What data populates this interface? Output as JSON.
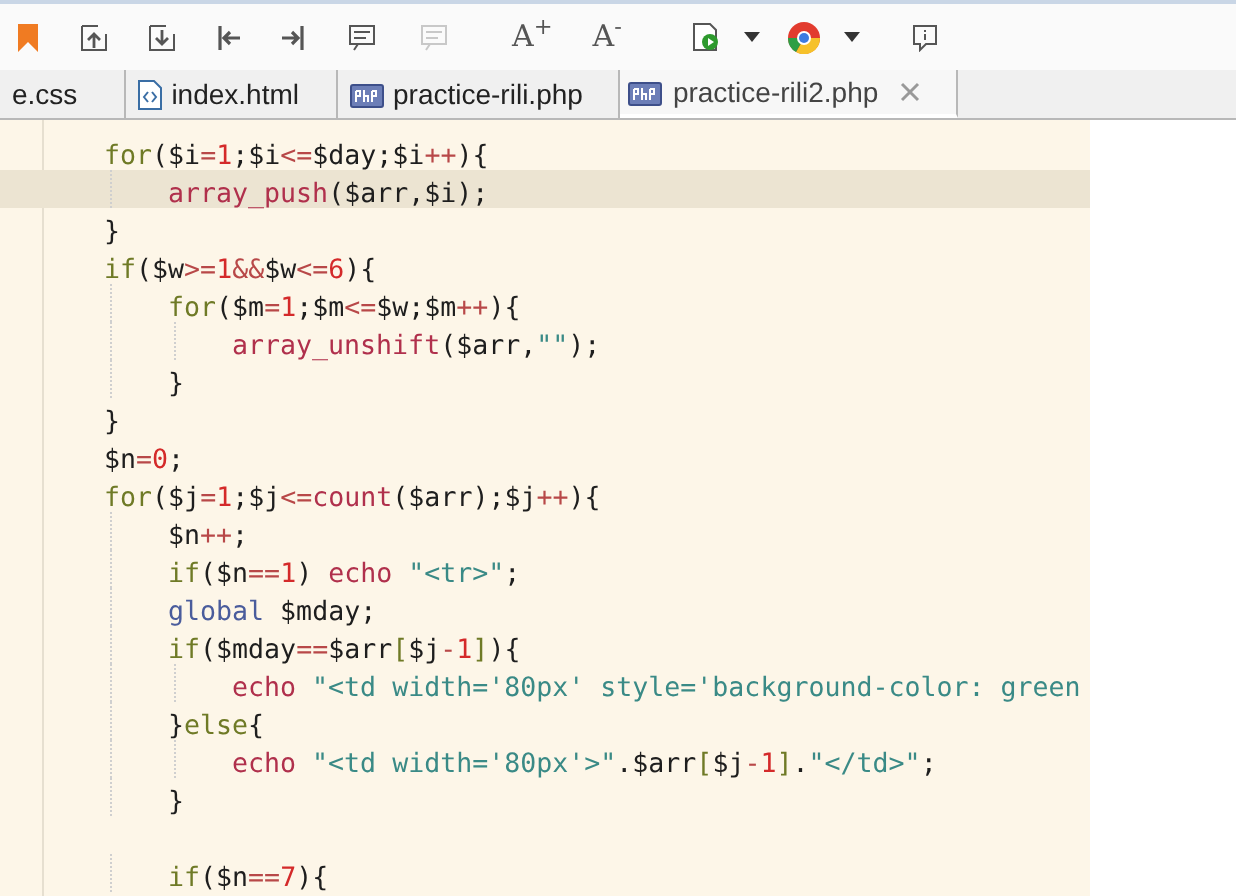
{
  "toolbar": [
    {
      "kind": "bookmark",
      "disabled": false
    },
    {
      "kind": "import",
      "disabled": false
    },
    {
      "kind": "export",
      "disabled": false
    },
    {
      "kind": "go-first",
      "disabled": false
    },
    {
      "kind": "go-last",
      "disabled": false
    },
    {
      "kind": "comment",
      "disabled": false
    },
    {
      "kind": "comment",
      "disabled": true
    },
    {
      "kind": "text",
      "label": "A$^{+}$",
      "disabled": false
    },
    {
      "kind": "text",
      "label": "A$^{-}$",
      "disabled": false
    },
    {
      "kind": "run",
      "disabled": false
    },
    {
      "kind": "caret",
      "disabled": false
    },
    {
      "kind": "browser",
      "disabled": false
    },
    {
      "kind": "caret",
      "disabled": false
    },
    {
      "kind": "info",
      "disabled": false
    }
  ],
  "tabs": [
    {
      "label": "e.css",
      "kind": "css",
      "selected": false
    },
    {
      "label": "index.html",
      "kind": "html",
      "selected": false
    },
    {
      "label": "practice-rili.php",
      "kind": "php",
      "selected": false
    },
    {
      "label": "practice-rili2.php",
      "kind": "php",
      "selected": true,
      "closable": true
    }
  ],
  "code": [
    {
      "tokens": [
        {
          "kind": "kw",
          "text": "for"
        },
        {
          "kind": "p",
          "text": "($i"
        },
        {
          "kind": "op",
          "text": "="
        },
        {
          "kind": "num",
          "text": "1"
        },
        {
          "kind": "p",
          "text": ";$i"
        },
        {
          "kind": "op",
          "text": "<="
        },
        {
          "kind": "p",
          "text": "$day;$i"
        },
        {
          "kind": "op",
          "text": "++"
        },
        {
          "kind": "p",
          "text": "){"
        }
      ],
      "children": [
        {
          "highlighted": true,
          "tokens": [
            {
              "kind": "fn",
              "text": "array_push"
            },
            {
              "kind": "p",
              "text": "($arr,$i);"
            }
          ]
        }
      ]
    },
    {
      "tokens": [
        {
          "kind": "p",
          "text": "}"
        }
      ]
    },
    {
      "tokens": [
        {
          "kind": "kw",
          "text": "if"
        },
        {
          "kind": "p",
          "text": "($w"
        },
        {
          "kind": "op",
          "text": ">="
        },
        {
          "kind": "num",
          "text": "1"
        },
        {
          "kind": "op",
          "text": "&&"
        },
        {
          "kind": "p",
          "text": "$w"
        },
        {
          "kind": "op",
          "text": "<="
        },
        {
          "kind": "num",
          "text": "6"
        },
        {
          "kind": "p",
          "text": "){"
        }
      ],
      "children": [
        {
          "tokens": [
            {
              "kind": "kw",
              "text": "for"
            },
            {
              "kind": "p",
              "text": "($m"
            },
            {
              "kind": "op",
              "text": "="
            },
            {
              "kind": "num",
              "text": "1"
            },
            {
              "kind": "p",
              "text": ";$m"
            },
            {
              "kind": "op",
              "text": "<="
            },
            {
              "kind": "p",
              "text": "$w;$m"
            },
            {
              "kind": "op",
              "text": "++"
            },
            {
              "kind": "p",
              "text": "){"
            }
          ],
          "children": [
            {
              "tokens": [
                {
                  "kind": "fn",
                  "text": "array_unshift"
                },
                {
                  "kind": "p",
                  "text": "($arr,"
                },
                {
                  "kind": "str",
                  "text": "\"\""
                },
                {
                  "kind": "p",
                  "text": ");"
                }
              ]
            }
          ]
        },
        {
          "tokens": [
            {
              "kind": "p",
              "text": "}"
            }
          ]
        }
      ]
    },
    {
      "tokens": [
        {
          "kind": "p",
          "text": "}"
        }
      ]
    },
    {
      "tokens": [
        {
          "kind": "p",
          "text": "$n"
        },
        {
          "kind": "op",
          "text": "="
        },
        {
          "kind": "num",
          "text": "0"
        },
        {
          "kind": "p",
          "text": ";"
        }
      ]
    },
    {
      "tokens": [
        {
          "kind": "kw",
          "text": "for"
        },
        {
          "kind": "p",
          "text": "($j"
        },
        {
          "kind": "op",
          "text": "="
        },
        {
          "kind": "num",
          "text": "1"
        },
        {
          "kind": "p",
          "text": ";$j"
        },
        {
          "kind": "op",
          "text": "<="
        },
        {
          "kind": "fn",
          "text": "count"
        },
        {
          "kind": "p",
          "text": "($arr);$j"
        },
        {
          "kind": "op",
          "text": "++"
        },
        {
          "kind": "p",
          "text": "){"
        }
      ],
      "children": [
        {
          "tokens": [
            {
              "kind": "p",
              "text": "$n"
            },
            {
              "kind": "op",
              "text": "++"
            },
            {
              "kind": "p",
              "text": ";"
            }
          ]
        },
        {
          "tokens": [
            {
              "kind": "kw",
              "text": "if"
            },
            {
              "kind": "p",
              "text": "($n"
            },
            {
              "kind": "op",
              "text": "=="
            },
            {
              "kind": "num",
              "text": "1"
            },
            {
              "kind": "p",
              "text": ") "
            },
            {
              "kind": "fn",
              "text": "echo"
            },
            {
              "kind": "str",
              "text": " \"<tr>\""
            },
            {
              "kind": "p",
              "text": ";"
            }
          ]
        },
        {
          "tokens": [
            {
              "kind": "glob",
              "text": "global"
            },
            {
              "kind": "p",
              "text": " $mday;"
            }
          ]
        },
        {
          "tokens": [
            {
              "kind": "kw",
              "text": "if"
            },
            {
              "kind": "p",
              "text": "($mday"
            },
            {
              "kind": "op",
              "text": "=="
            },
            {
              "kind": "p",
              "text": "$arr"
            },
            {
              "kind": "kw",
              "text": "["
            },
            {
              "kind": "p",
              "text": "$j"
            },
            {
              "kind": "op",
              "text": "-"
            },
            {
              "kind": "num",
              "text": "1"
            },
            {
              "kind": "kw",
              "text": "]"
            },
            {
              "kind": "p",
              "text": "){"
            }
          ],
          "children": [
            {
              "tokens": [
                {
                  "kind": "fn",
                  "text": "echo"
                },
                {
                  "kind": "str",
                  "text": " \"<td width='80px' style='background-color: green"
                }
              ]
            }
          ]
        },
        {
          "tokens": [
            {
              "kind": "p",
              "text": "}"
            },
            {
              "kind": "kw",
              "text": "else"
            },
            {
              "kind": "p",
              "text": "{"
            }
          ],
          "children": [
            {
              "tokens": [
                {
                  "kind": "fn",
                  "text": "echo"
                },
                {
                  "kind": "str",
                  "text": " \"<td width='80px'>\""
                },
                {
                  "kind": "p",
                  "text": ".$arr"
                },
                {
                  "kind": "kw",
                  "text": "["
                },
                {
                  "kind": "p",
                  "text": "$j"
                },
                {
                  "kind": "op",
                  "text": "-"
                },
                {
                  "kind": "num",
                  "text": "1"
                },
                {
                  "kind": "kw",
                  "text": "]"
                },
                {
                  "kind": "p",
                  "text": "."
                },
                {
                  "kind": "str",
                  "text": "\"</td>\""
                },
                {
                  "kind": "p",
                  "text": ";"
                }
              ]
            }
          ]
        },
        {
          "tokens": [
            {
              "kind": "p",
              "text": "}"
            }
          ]
        },
        {
          "kind": "blank"
        },
        {
          "tokens": [
            {
              "kind": "kw",
              "text": "if"
            },
            {
              "kind": "p",
              "text": "($n"
            },
            {
              "kind": "op",
              "text": "=="
            },
            {
              "kind": "num",
              "text": "7"
            },
            {
              "kind": "p",
              "text": "){"
            }
          ]
        }
      ]
    }
  ]
}
